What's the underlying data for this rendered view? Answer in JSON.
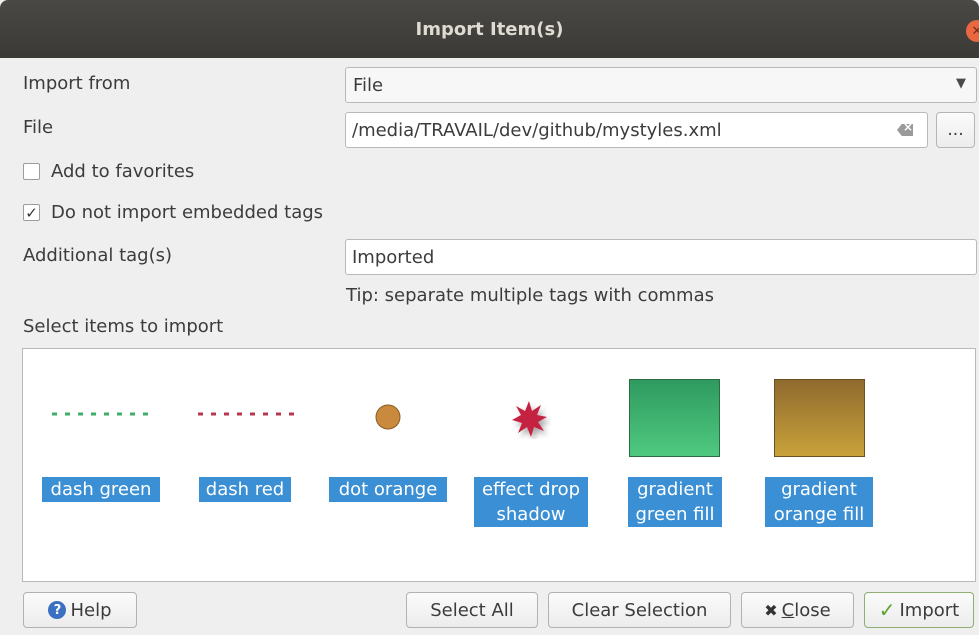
{
  "window": {
    "title": "Import Item(s)"
  },
  "form": {
    "import_from_label": "Import from",
    "import_from_value": "File",
    "file_label": "File",
    "file_value": "/media/TRAVAIL/dev/github/mystyles.xml",
    "browse_label": "...",
    "add_to_favorites_label": "Add to favorites",
    "add_to_favorites_checked": false,
    "no_embedded_tags_label": "Do not import embedded tags",
    "no_embedded_tags_checked": true,
    "additional_tags_label": "Additional tag(s)",
    "additional_tags_value": "Imported",
    "tip": "Tip: separate multiple tags with commas",
    "select_items_label": "Select items to import"
  },
  "items": [
    {
      "label_line1": "dash green",
      "label_line2": "",
      "icon": "dash-line-icon",
      "color": "#3fae6a"
    },
    {
      "label_line1": "dash red",
      "label_line2": "",
      "icon": "dash-line-icon",
      "color": "#b8374f"
    },
    {
      "label_line1": "dot orange",
      "label_line2": "",
      "icon": "dot-icon",
      "color": "#c98a3e"
    },
    {
      "label_line1": "effect drop",
      "label_line2": "shadow",
      "icon": "starburst-icon",
      "color": "#c4213f"
    },
    {
      "label_line1": "gradient",
      "label_line2": "green fill",
      "icon": "gradient-square-icon",
      "color": "#3cb46f"
    },
    {
      "label_line1": "gradient",
      "label_line2": "orange fill",
      "icon": "gradient-square-icon",
      "color": "#b58a2d"
    }
  ],
  "buttons": {
    "help": "Help",
    "select_all": "Select All",
    "clear_selection": "Clear Selection",
    "close_mnemonic": "C",
    "close_rest": "lose",
    "import": "Import"
  },
  "colors": {
    "selection": "#3b8fd4",
    "titlebar": "#3c3b37"
  }
}
